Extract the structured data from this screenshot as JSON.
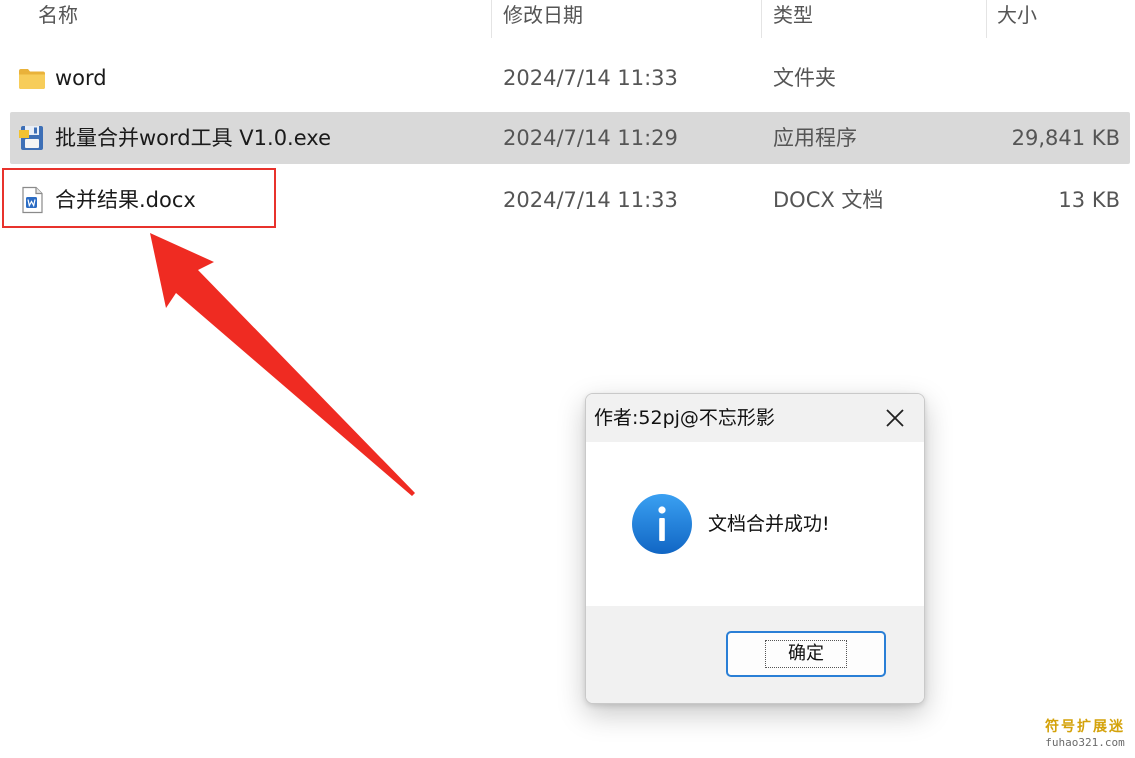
{
  "columns": {
    "name": "名称",
    "modified": "修改日期",
    "type": "类型",
    "size": "大小"
  },
  "files": [
    {
      "name": "word",
      "modified": "2024/7/14 11:33",
      "type": "文件夹",
      "size": "",
      "icon": "folder-icon",
      "selected": false
    },
    {
      "name": "批量合并word工具 V1.0.exe",
      "modified": "2024/7/14 11:29",
      "type": "应用程序",
      "size": "29,841 KB",
      "icon": "application-icon",
      "selected": true
    },
    {
      "name": "合并结果.docx",
      "modified": "2024/7/14 11:33",
      "type": "DOCX 文档",
      "size": "13 KB",
      "icon": "word-document-icon",
      "selected": false
    }
  ],
  "annotation": {
    "color": "#e8322c",
    "target": "合并结果.docx"
  },
  "dialog": {
    "title": "作者:52pj@不忘形影",
    "message": "文档合并成功!",
    "ok_label": "确定",
    "icon": "info-icon",
    "accent": "#2a7fd6"
  },
  "watermark": {
    "brand": "符号扩展迷",
    "domain": "fuhao321.com"
  },
  "colors": {
    "selection": "#d9d9d9",
    "folder": "#f0c040",
    "info": "#1a7fd8"
  }
}
